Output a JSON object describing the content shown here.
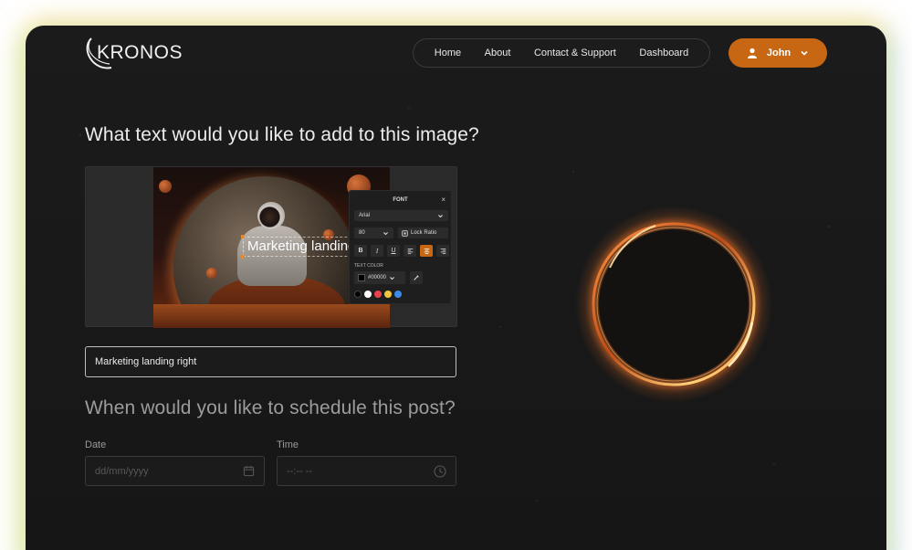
{
  "brand": {
    "logo_text": "KRONOS"
  },
  "nav": {
    "items": [
      {
        "label": "Home"
      },
      {
        "label": "About"
      },
      {
        "label": "Contact & Support"
      },
      {
        "label": "Dashboard"
      }
    ]
  },
  "user": {
    "name": "John",
    "icon": "user-icon"
  },
  "editor": {
    "heading": "What text would you like to add to this image?",
    "overlay_text": "Marketing landing right",
    "font_panel": {
      "title": "FONT",
      "close": "×",
      "font_family": "Arial",
      "font_size": "80",
      "lock_ratio": "Lock Ratio",
      "format_buttons": [
        "B",
        "I",
        "U"
      ],
      "text_color_label": "TEXT COLOR",
      "color_value": "#00000",
      "swatches": [
        "#000000",
        "#ffffff",
        "#e8424f",
        "#f2c43a",
        "#3c8be8"
      ]
    }
  },
  "text_input": {
    "value": "Marketing landing right"
  },
  "schedule": {
    "heading": "When would you like to schedule this post?",
    "date_label": "Date",
    "date_placeholder": "dd/mm/yyyy",
    "time_label": "Time",
    "time_placeholder": "--:-- --"
  },
  "colors": {
    "accent": "#c76714",
    "background": "#171717"
  }
}
